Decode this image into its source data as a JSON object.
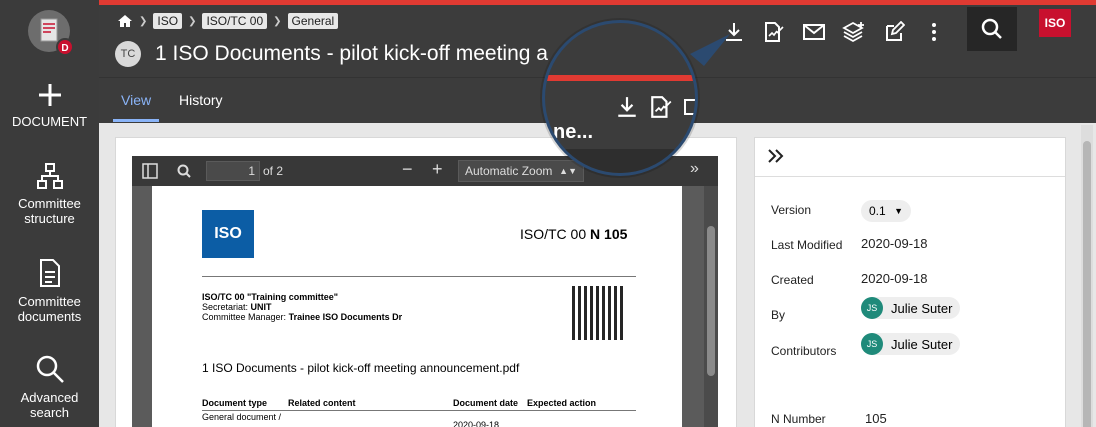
{
  "sidebar": {
    "badge": "D",
    "items": [
      {
        "label": "DOCUMENT",
        "icon": "plus-icon"
      },
      {
        "label": "Committee structure",
        "icon": "hierarchy-icon"
      },
      {
        "label": "Committee documents",
        "icon": "document-icon"
      },
      {
        "label": "Advanced search",
        "icon": "search-icon"
      }
    ]
  },
  "header": {
    "breadcrumb": [
      "ISO",
      "ISO/TC 00",
      "General"
    ],
    "avatar": "TC",
    "title": "1 ISO Documents - pilot kick-off meeting a",
    "iso_logo": "ISO"
  },
  "tabs": [
    {
      "label": "View",
      "active": true
    },
    {
      "label": "History",
      "active": false
    }
  ],
  "pdf_viewer": {
    "page": "1",
    "of_pages": "of 2",
    "zoom": "Automatic Zoom",
    "page_content": {
      "logo": "ISO",
      "ref_prefix": "ISO/TC 00",
      "ref_number": "N 105",
      "committee": "ISO/TC 00 \"Training committee\"",
      "secretariat_label": "Secretariat:",
      "secretariat": "UNIT",
      "manager_label": "Committee Manager:",
      "manager": "Trainee ISO Documents Dr",
      "doc_name": "1 ISO Documents - pilot kick-off meeting announcement.pdf",
      "table_headers": [
        "Document type",
        "Related content",
        "Document date",
        "Expected action"
      ],
      "row_type": "General document /",
      "row_date": "2020-09-18"
    }
  },
  "info": {
    "version_label": "Version",
    "version": "0.1",
    "last_modified_label": "Last Modified",
    "last_modified": "2020-09-18",
    "created_label": "Created",
    "created": "2020-09-18",
    "by_label": "By",
    "by_initials": "JS",
    "by": "Julie Suter",
    "contributors_label": "Contributors",
    "contributor_initials": "JS",
    "contributor": "Julie Suter",
    "n_number_label": "N Number",
    "n_number": "105"
  },
  "magnifier": {
    "text": "ne..."
  }
}
